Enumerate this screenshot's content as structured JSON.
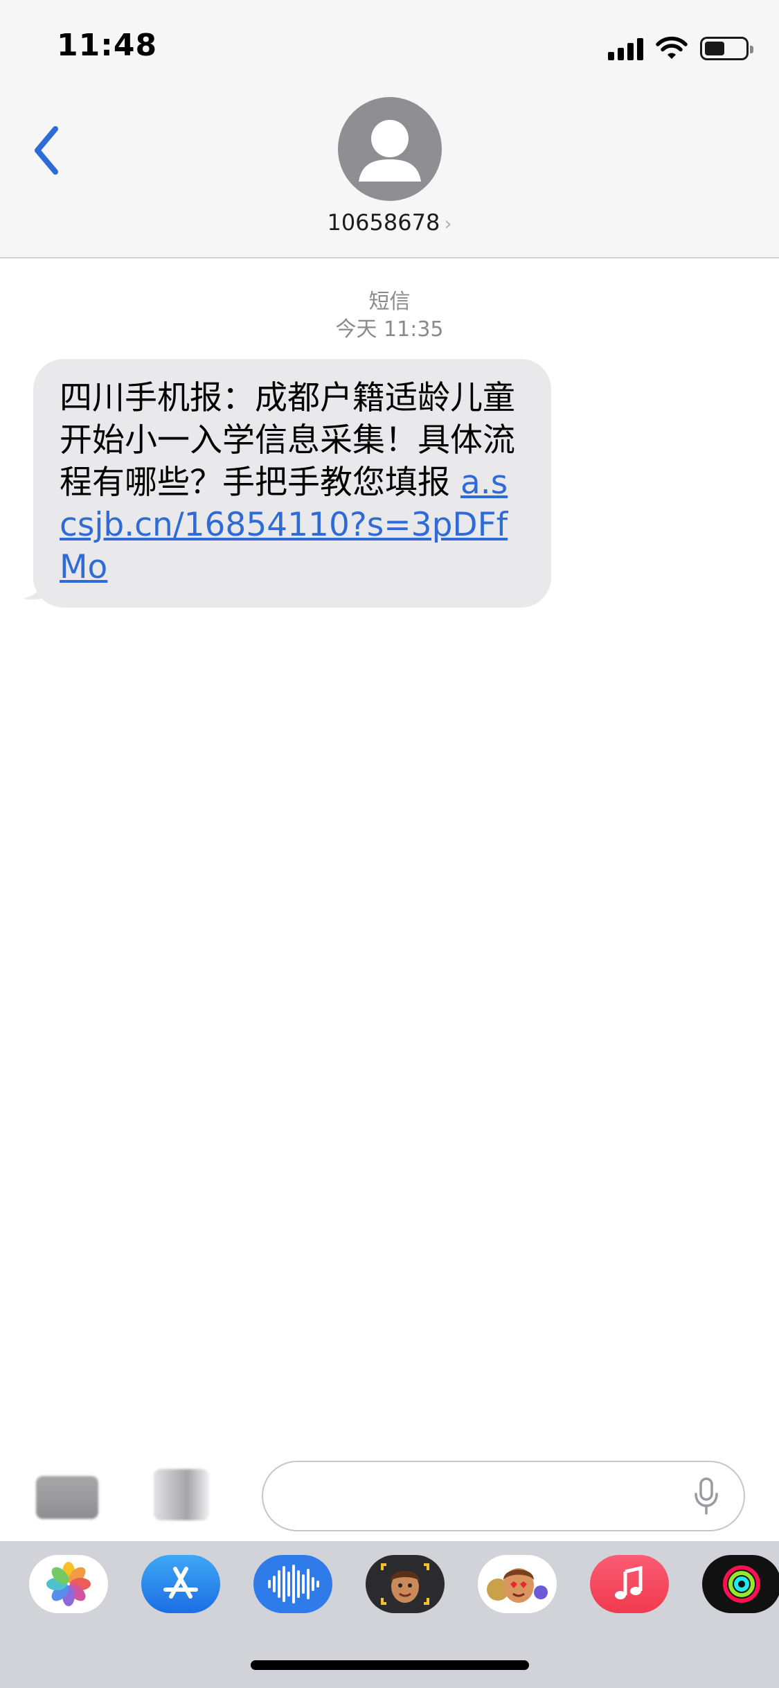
{
  "status_bar": {
    "time": "11:48",
    "battery_level": 0.5
  },
  "header": {
    "back_icon": "chevron-left-icon",
    "avatar_icon": "person-silhouette-icon",
    "contact_name": "10658678",
    "contact_chevron": "›"
  },
  "thread": {
    "service_label": "短信",
    "timestamp": "今天 11:35",
    "messages": [
      {
        "direction": "incoming",
        "text": "四川手机报：成都户籍适龄儿童开始小一入学信息采集！具体流程有哪些？手把手教您填报 ",
        "link": "a.scsjb.cn/16854110?s=3pDFfMo"
      }
    ]
  },
  "compose": {
    "text": "",
    "mic_icon": "microphone-icon"
  },
  "app_drawer": {
    "apps": [
      {
        "name": "photos-app-icon"
      },
      {
        "name": "app-store-app-icon"
      },
      {
        "name": "audio-message-app-icon"
      },
      {
        "name": "memoji-camera-app-icon"
      },
      {
        "name": "memoji-stickers-app-icon"
      },
      {
        "name": "music-app-icon"
      },
      {
        "name": "activity-app-icon"
      }
    ]
  },
  "colors": {
    "accent": "#2f6bd8",
    "header_bg": "#f6f6f6",
    "bubble_bg": "#e9e9eb",
    "drawer_bg": "#d1d3d9"
  }
}
